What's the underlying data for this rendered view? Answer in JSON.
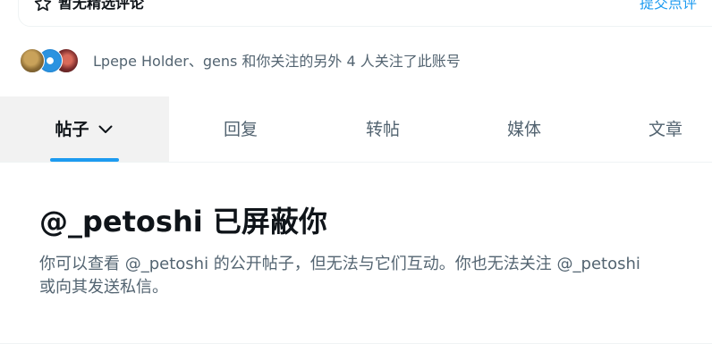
{
  "highlights": {
    "empty_text": "暂无精选评论",
    "submit_link": "提交点评"
  },
  "followers": {
    "text": "Lpepe Holder、gens 和你关注的另外 4 人关注了此账号"
  },
  "tabs": [
    {
      "label": "帖子",
      "active": true
    },
    {
      "label": "回复",
      "active": false
    },
    {
      "label": "转帖",
      "active": false
    },
    {
      "label": "媒体",
      "active": false
    },
    {
      "label": "文章",
      "active": false
    }
  ],
  "blocked": {
    "title": "@_petoshi 已屏蔽你",
    "description": "你可以查看 @_petoshi 的公开帖子，但无法与它们互动。你也无法关注 @_petoshi 或向其发送私信。"
  },
  "colors": {
    "accent": "#1d9bf0",
    "text_primary": "#0f1419",
    "text_secondary": "#536471",
    "active_tab_bg": "#f2f2f2"
  },
  "icons": [
    "star-icon",
    "chevron-down-icon"
  ]
}
